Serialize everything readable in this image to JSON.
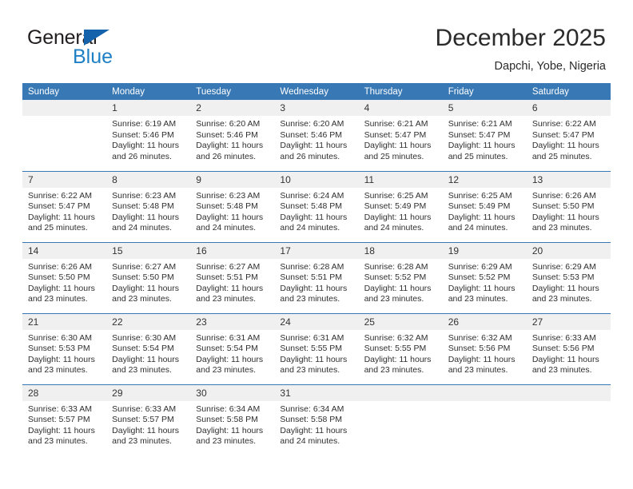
{
  "brand": {
    "name_top": "General",
    "name_bottom": "Blue",
    "triangle_color": "#1362ab",
    "blue_text_color": "#1f7fc4"
  },
  "header": {
    "title": "December 2025",
    "subtitle": "Dapchi, Yobe, Nigeria"
  },
  "theme": {
    "header_blue": "#3878b4",
    "daynum_bg": "#f0f0f0",
    "text": "#2f2f2f"
  },
  "weekdays": [
    "Sunday",
    "Monday",
    "Tuesday",
    "Wednesday",
    "Thursday",
    "Friday",
    "Saturday"
  ],
  "weeks": [
    [
      {
        "day": "",
        "sunrise": "",
        "sunset": "",
        "daylight": ""
      },
      {
        "day": "1",
        "sunrise": "Sunrise: 6:19 AM",
        "sunset": "Sunset: 5:46 PM",
        "daylight": "Daylight: 11 hours and 26 minutes."
      },
      {
        "day": "2",
        "sunrise": "Sunrise: 6:20 AM",
        "sunset": "Sunset: 5:46 PM",
        "daylight": "Daylight: 11 hours and 26 minutes."
      },
      {
        "day": "3",
        "sunrise": "Sunrise: 6:20 AM",
        "sunset": "Sunset: 5:46 PM",
        "daylight": "Daylight: 11 hours and 26 minutes."
      },
      {
        "day": "4",
        "sunrise": "Sunrise: 6:21 AM",
        "sunset": "Sunset: 5:47 PM",
        "daylight": "Daylight: 11 hours and 25 minutes."
      },
      {
        "day": "5",
        "sunrise": "Sunrise: 6:21 AM",
        "sunset": "Sunset: 5:47 PM",
        "daylight": "Daylight: 11 hours and 25 minutes."
      },
      {
        "day": "6",
        "sunrise": "Sunrise: 6:22 AM",
        "sunset": "Sunset: 5:47 PM",
        "daylight": "Daylight: 11 hours and 25 minutes."
      }
    ],
    [
      {
        "day": "7",
        "sunrise": "Sunrise: 6:22 AM",
        "sunset": "Sunset: 5:47 PM",
        "daylight": "Daylight: 11 hours and 25 minutes."
      },
      {
        "day": "8",
        "sunrise": "Sunrise: 6:23 AM",
        "sunset": "Sunset: 5:48 PM",
        "daylight": "Daylight: 11 hours and 24 minutes."
      },
      {
        "day": "9",
        "sunrise": "Sunrise: 6:23 AM",
        "sunset": "Sunset: 5:48 PM",
        "daylight": "Daylight: 11 hours and 24 minutes."
      },
      {
        "day": "10",
        "sunrise": "Sunrise: 6:24 AM",
        "sunset": "Sunset: 5:48 PM",
        "daylight": "Daylight: 11 hours and 24 minutes."
      },
      {
        "day": "11",
        "sunrise": "Sunrise: 6:25 AM",
        "sunset": "Sunset: 5:49 PM",
        "daylight": "Daylight: 11 hours and 24 minutes."
      },
      {
        "day": "12",
        "sunrise": "Sunrise: 6:25 AM",
        "sunset": "Sunset: 5:49 PM",
        "daylight": "Daylight: 11 hours and 24 minutes."
      },
      {
        "day": "13",
        "sunrise": "Sunrise: 6:26 AM",
        "sunset": "Sunset: 5:50 PM",
        "daylight": "Daylight: 11 hours and 23 minutes."
      }
    ],
    [
      {
        "day": "14",
        "sunrise": "Sunrise: 6:26 AM",
        "sunset": "Sunset: 5:50 PM",
        "daylight": "Daylight: 11 hours and 23 minutes."
      },
      {
        "day": "15",
        "sunrise": "Sunrise: 6:27 AM",
        "sunset": "Sunset: 5:50 PM",
        "daylight": "Daylight: 11 hours and 23 minutes."
      },
      {
        "day": "16",
        "sunrise": "Sunrise: 6:27 AM",
        "sunset": "Sunset: 5:51 PM",
        "daylight": "Daylight: 11 hours and 23 minutes."
      },
      {
        "day": "17",
        "sunrise": "Sunrise: 6:28 AM",
        "sunset": "Sunset: 5:51 PM",
        "daylight": "Daylight: 11 hours and 23 minutes."
      },
      {
        "day": "18",
        "sunrise": "Sunrise: 6:28 AM",
        "sunset": "Sunset: 5:52 PM",
        "daylight": "Daylight: 11 hours and 23 minutes."
      },
      {
        "day": "19",
        "sunrise": "Sunrise: 6:29 AM",
        "sunset": "Sunset: 5:52 PM",
        "daylight": "Daylight: 11 hours and 23 minutes."
      },
      {
        "day": "20",
        "sunrise": "Sunrise: 6:29 AM",
        "sunset": "Sunset: 5:53 PM",
        "daylight": "Daylight: 11 hours and 23 minutes."
      }
    ],
    [
      {
        "day": "21",
        "sunrise": "Sunrise: 6:30 AM",
        "sunset": "Sunset: 5:53 PM",
        "daylight": "Daylight: 11 hours and 23 minutes."
      },
      {
        "day": "22",
        "sunrise": "Sunrise: 6:30 AM",
        "sunset": "Sunset: 5:54 PM",
        "daylight": "Daylight: 11 hours and 23 minutes."
      },
      {
        "day": "23",
        "sunrise": "Sunrise: 6:31 AM",
        "sunset": "Sunset: 5:54 PM",
        "daylight": "Daylight: 11 hours and 23 minutes."
      },
      {
        "day": "24",
        "sunrise": "Sunrise: 6:31 AM",
        "sunset": "Sunset: 5:55 PM",
        "daylight": "Daylight: 11 hours and 23 minutes."
      },
      {
        "day": "25",
        "sunrise": "Sunrise: 6:32 AM",
        "sunset": "Sunset: 5:55 PM",
        "daylight": "Daylight: 11 hours and 23 minutes."
      },
      {
        "day": "26",
        "sunrise": "Sunrise: 6:32 AM",
        "sunset": "Sunset: 5:56 PM",
        "daylight": "Daylight: 11 hours and 23 minutes."
      },
      {
        "day": "27",
        "sunrise": "Sunrise: 6:33 AM",
        "sunset": "Sunset: 5:56 PM",
        "daylight": "Daylight: 11 hours and 23 minutes."
      }
    ],
    [
      {
        "day": "28",
        "sunrise": "Sunrise: 6:33 AM",
        "sunset": "Sunset: 5:57 PM",
        "daylight": "Daylight: 11 hours and 23 minutes."
      },
      {
        "day": "29",
        "sunrise": "Sunrise: 6:33 AM",
        "sunset": "Sunset: 5:57 PM",
        "daylight": "Daylight: 11 hours and 23 minutes."
      },
      {
        "day": "30",
        "sunrise": "Sunrise: 6:34 AM",
        "sunset": "Sunset: 5:58 PM",
        "daylight": "Daylight: 11 hours and 23 minutes."
      },
      {
        "day": "31",
        "sunrise": "Sunrise: 6:34 AM",
        "sunset": "Sunset: 5:58 PM",
        "daylight": "Daylight: 11 hours and 24 minutes."
      },
      {
        "day": "",
        "sunrise": "",
        "sunset": "",
        "daylight": ""
      },
      {
        "day": "",
        "sunrise": "",
        "sunset": "",
        "daylight": ""
      },
      {
        "day": "",
        "sunrise": "",
        "sunset": "",
        "daylight": ""
      }
    ]
  ]
}
